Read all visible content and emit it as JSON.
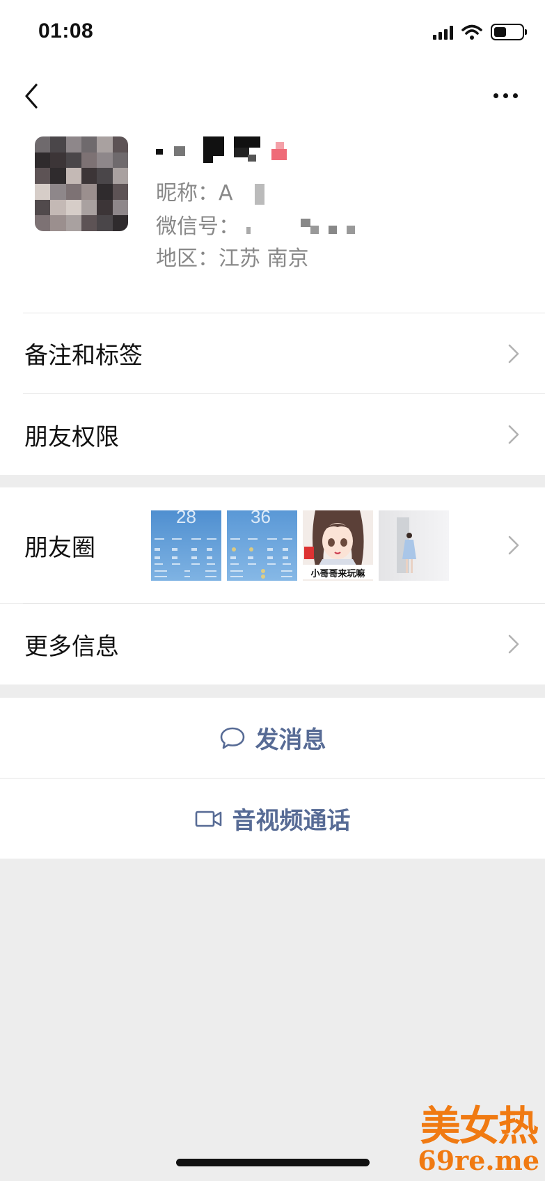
{
  "status_bar": {
    "time": "01:08"
  },
  "profile": {
    "nickname_label": "昵称：A",
    "wechat_id_label": "微信号：",
    "region_label": "地区：江苏 南京"
  },
  "menu": {
    "remarks_tags": "备注和标签",
    "friend_permissions": "朋友权限",
    "moments": "朋友圈",
    "more_info": "更多信息"
  },
  "moments_thumbs": [
    {
      "kind": "weather-screenshot",
      "temp": "28"
    },
    {
      "kind": "weather-screenshot",
      "temp": "36"
    },
    {
      "kind": "anime-girl",
      "caption": "小哥哥来玩嘛"
    },
    {
      "kind": "photo"
    }
  ],
  "actions": {
    "send_message": "发消息",
    "video_call": "音视频通话"
  },
  "watermark": {
    "top": "美女热",
    "bottom": "69re.me"
  },
  "colors": {
    "link_blue": "#576b95",
    "page_bg": "#ededed",
    "watermark": "#f07a12"
  }
}
